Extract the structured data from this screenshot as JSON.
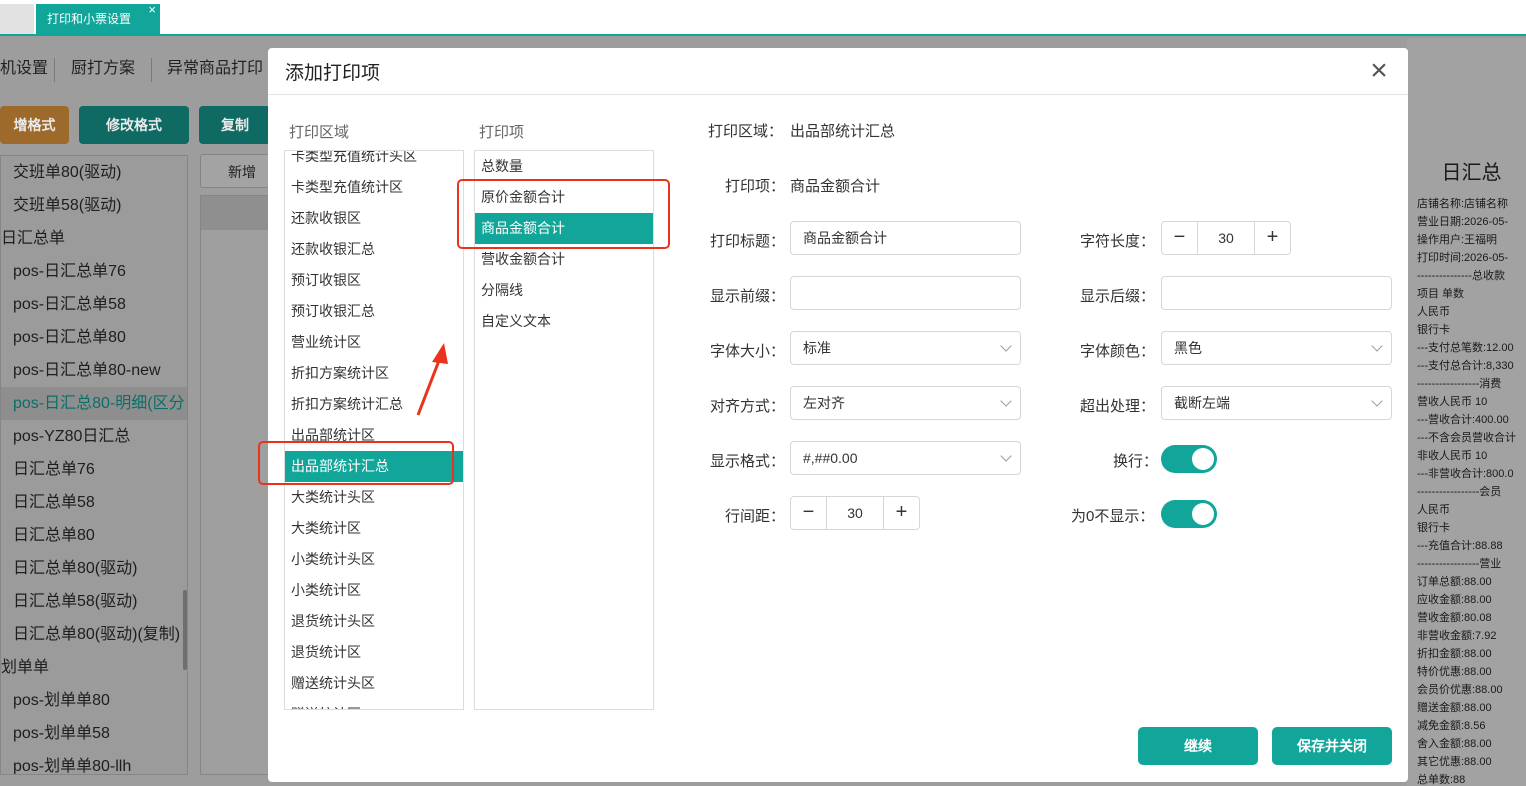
{
  "tabs": {
    "active_label": "打印和小票设置",
    "close_glyph": "×"
  },
  "background": {
    "subnav": [
      "机设置",
      "厨打方案",
      "异常商品打印"
    ],
    "buttons": [
      "增格式",
      "修改格式",
      "复制"
    ],
    "new_button": "新增项",
    "format_list": [
      {
        "label": "交班单80(驱动)",
        "indent": 1
      },
      {
        "label": "交班单58(驱动)",
        "indent": 1
      },
      {
        "label": "日汇总单",
        "indent": 0
      },
      {
        "label": "pos-日汇总单76",
        "indent": 1
      },
      {
        "label": "pos-日汇总单58",
        "indent": 1
      },
      {
        "label": "pos-日汇总单80",
        "indent": 1
      },
      {
        "label": "pos-日汇总单80-new",
        "indent": 1
      },
      {
        "label": "pos-日汇总80-明细(区分",
        "indent": 1,
        "selected": true
      },
      {
        "label": "pos-YZ80日汇总",
        "indent": 1
      },
      {
        "label": "日汇总单76",
        "indent": 1
      },
      {
        "label": "日汇总单58",
        "indent": 1
      },
      {
        "label": "日汇总单80",
        "indent": 1
      },
      {
        "label": "日汇总单80(驱动)",
        "indent": 1
      },
      {
        "label": "日汇总单58(驱动)",
        "indent": 1
      },
      {
        "label": "日汇总单80(驱动)(复制)",
        "indent": 1
      },
      {
        "label": "划单单",
        "indent": 0
      },
      {
        "label": "pos-划单单80",
        "indent": 1
      },
      {
        "label": "pos-划单单58",
        "indent": 1
      },
      {
        "label": "pos-划单单80-llh",
        "indent": 1
      }
    ],
    "receipt": {
      "title": "日汇总",
      "lines": [
        "店铺名称:店铺名称",
        "营业日期:2026-05-",
        "操作用户:王福明",
        "打印时间:2026-05-",
        "---------------总收款",
        "项目             单数",
        "人民币",
        "银行卡",
        "---支付总笔数:12.00",
        "---支付总合计:8,330",
        "-----------------消费",
        "营收人民币        10",
        "---营收合计:400.00",
        "---不含会员营收合计",
        "非收人民币        10",
        "---非营收合计:800.0",
        "-----------------会员",
        "人民币",
        "银行卡",
        "---充值合计:88.88",
        "-----------------营业",
        "订单总额:88.00",
        "应收金额:88.00",
        "营收金额:80.08",
        "非营收金额:7.92",
        "折扣金额:88.00",
        "特价优惠:88.00",
        "会员价优惠:88.00",
        "赠送金额:88.00",
        "减免金额:8.56",
        "舍入金额:88.00",
        "其它优惠:88.00",
        "总单数:88"
      ]
    }
  },
  "modal": {
    "title": "添加打印项",
    "close_glyph": "×",
    "areas_header": "打印区域",
    "items_header": "打印项",
    "areas": [
      "卡类型充值统计头区",
      "卡类型充值统计区",
      "还款收银区",
      "还款收银汇总",
      "预订收银区",
      "预订收银汇总",
      "营业统计区",
      "折扣方案统计区",
      "折扣方案统计汇总",
      "出品部统计区",
      "出品部统计汇总",
      "大类统计头区",
      "大类统计区",
      "小类统计头区",
      "小类统计区",
      "退货统计头区",
      "退货统计区",
      "赠送统计头区",
      "赠送统计区"
    ],
    "areas_selected_index": 10,
    "items": [
      "总数量",
      "原价金额合计",
      "商品金额合计",
      "营收金额合计",
      "分隔线",
      "自定义文本"
    ],
    "items_selected_index": 2,
    "form": {
      "area_label": "打印区域：",
      "area_value": "出品部统计汇总",
      "item_label": "打印项：",
      "item_value": "商品金额合计",
      "title_label": "打印标题：",
      "title_value": "商品金额合计",
      "prefix_label": "显示前缀：",
      "prefix_value": "",
      "suffix_label": "显示后缀：",
      "suffix_value": "",
      "charlen_label": "字符长度：",
      "charlen_value": "30",
      "fontsize_label": "字体大小：",
      "fontsize_value": "标准",
      "fontcolor_label": "字体颜色：",
      "fontcolor_value": "黑色",
      "align_label": "对齐方式：",
      "align_value": "左对齐",
      "overflow_label": "超出处理：",
      "overflow_value": "截断左端",
      "format_label": "显示格式：",
      "format_value": "#,##0.00",
      "wrap_label": "换行：",
      "wrap_on": true,
      "linespace_label": "行间距：",
      "linespace_value": "30",
      "hidezero_label": "为0不显示：",
      "hidezero_on": true,
      "minus": "−",
      "plus": "+"
    },
    "continue_label": "继续",
    "save_close_label": "保存并关闭"
  },
  "colors": {
    "accent": "#12a69a",
    "highlight_border": "#e8341c",
    "bg_button_orange": "#9e6a2c",
    "bg_button_teal": "#0e6a62"
  }
}
